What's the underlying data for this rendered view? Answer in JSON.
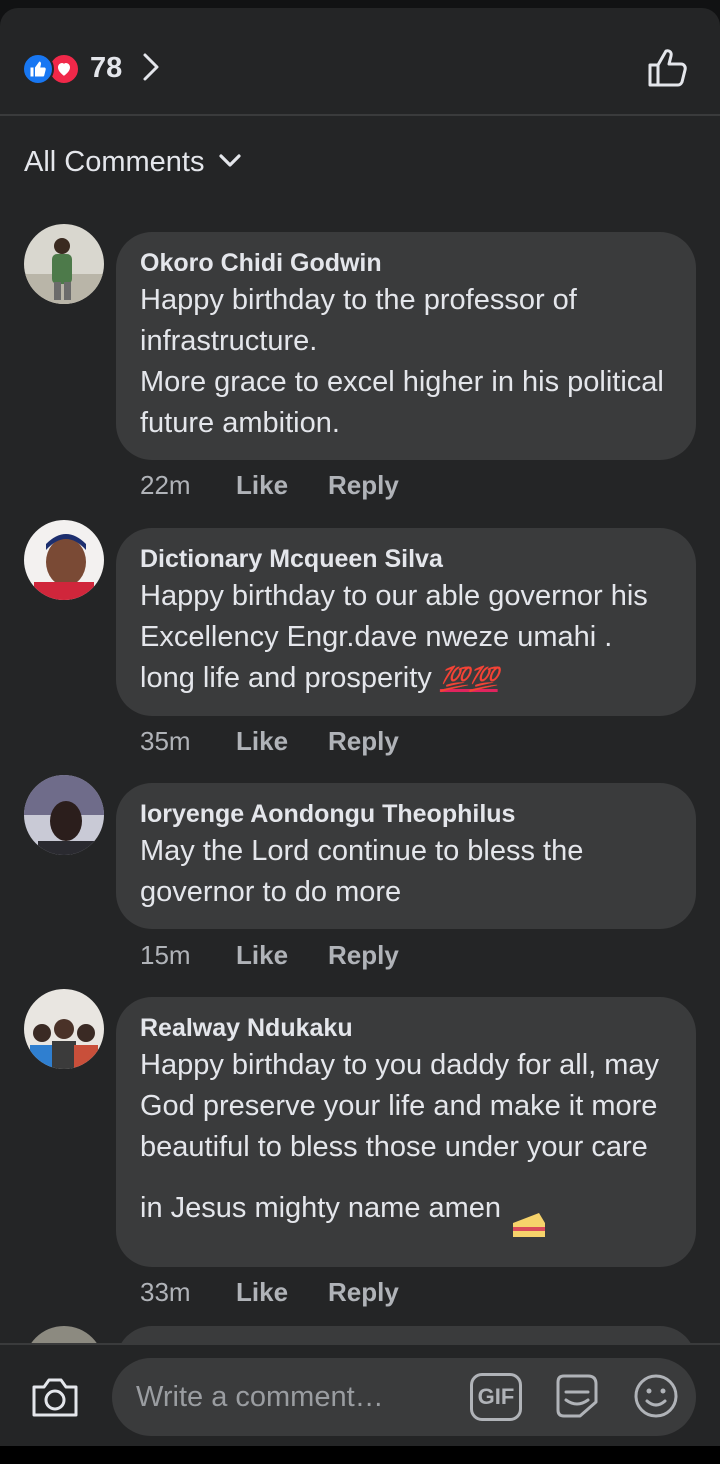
{
  "header": {
    "reaction_count": "78",
    "like_color": "#1877f2",
    "love_color": "#f02849"
  },
  "sort": {
    "label": "All Comments"
  },
  "comments": [
    {
      "author": "Okoro Chidi Godwin",
      "text": "Happy birthday to the professor of infrastructure.\nMore grace to excel higher in his political future ambition.",
      "time": "22m",
      "like": "Like",
      "reply": "Reply"
    },
    {
      "author": "Dictionary Mcqueen Silva",
      "text": "Happy birthday to our able governor his Excellency Engr.dave nweze umahi . long life and prosperity",
      "emoji": "💯💯",
      "time": "35m",
      "like": "Like",
      "reply": "Reply"
    },
    {
      "author": "Ioryenge Aondongu Theophilus",
      "text": "May the Lord continue to bless the governor to do more",
      "time": "15m",
      "like": "Like",
      "reply": "Reply"
    },
    {
      "author": "Realway Ndukaku",
      "text": "Happy birthday to you daddy for all, may God preserve your life and make it more beautiful to bless those under your care in Jesus mighty name amen",
      "time": "33m",
      "like": "Like",
      "reply": "Reply"
    }
  ],
  "composer": {
    "placeholder": "Write a comment…",
    "gif_label": "GIF"
  },
  "icons": [
    "like-reaction-icon",
    "love-reaction-icon",
    "chevron-right-icon",
    "thumbs-up-icon",
    "chevron-down-icon",
    "camera-icon",
    "gif-icon",
    "sticker-icon",
    "emoji-icon",
    "cake-icon"
  ]
}
